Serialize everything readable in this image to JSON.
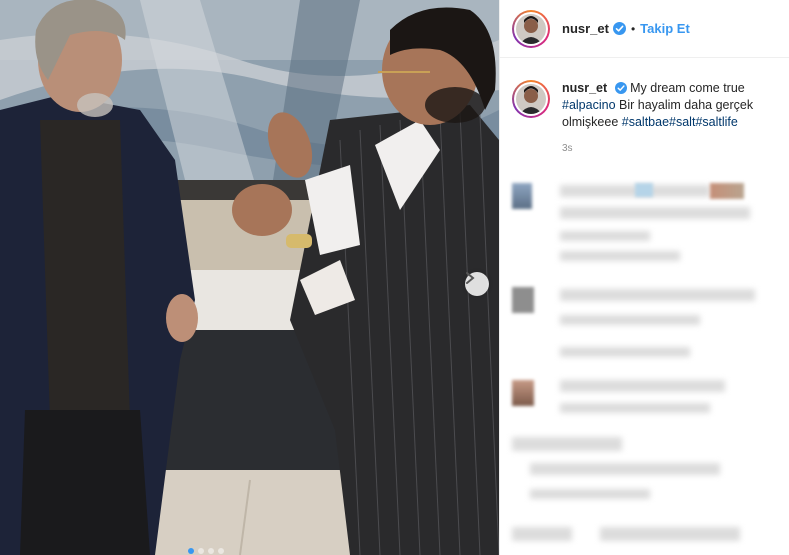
{
  "header": {
    "username": "nusr_et",
    "bullet": "•",
    "follow_label": "Takip Et"
  },
  "caption": {
    "username": "nusr_et",
    "text_start": "My dream come true",
    "tag_alpacino": "#alpacino",
    "text_middle": "Bir hayalim daha gerçek olmişkeee",
    "tag_saltbae": "#saltbae",
    "tag_salt": "#salt",
    "tag_saltlife": "#saltlife",
    "time": "3s"
  },
  "carousel": {
    "total_slides": 4,
    "active_slide": 1
  },
  "colors": {
    "link": "#3897f0",
    "hashtag": "#00376b",
    "verified": "#3897f0"
  },
  "icons": {
    "verified": "verified-badge-icon",
    "next": "chevron-right-icon"
  }
}
